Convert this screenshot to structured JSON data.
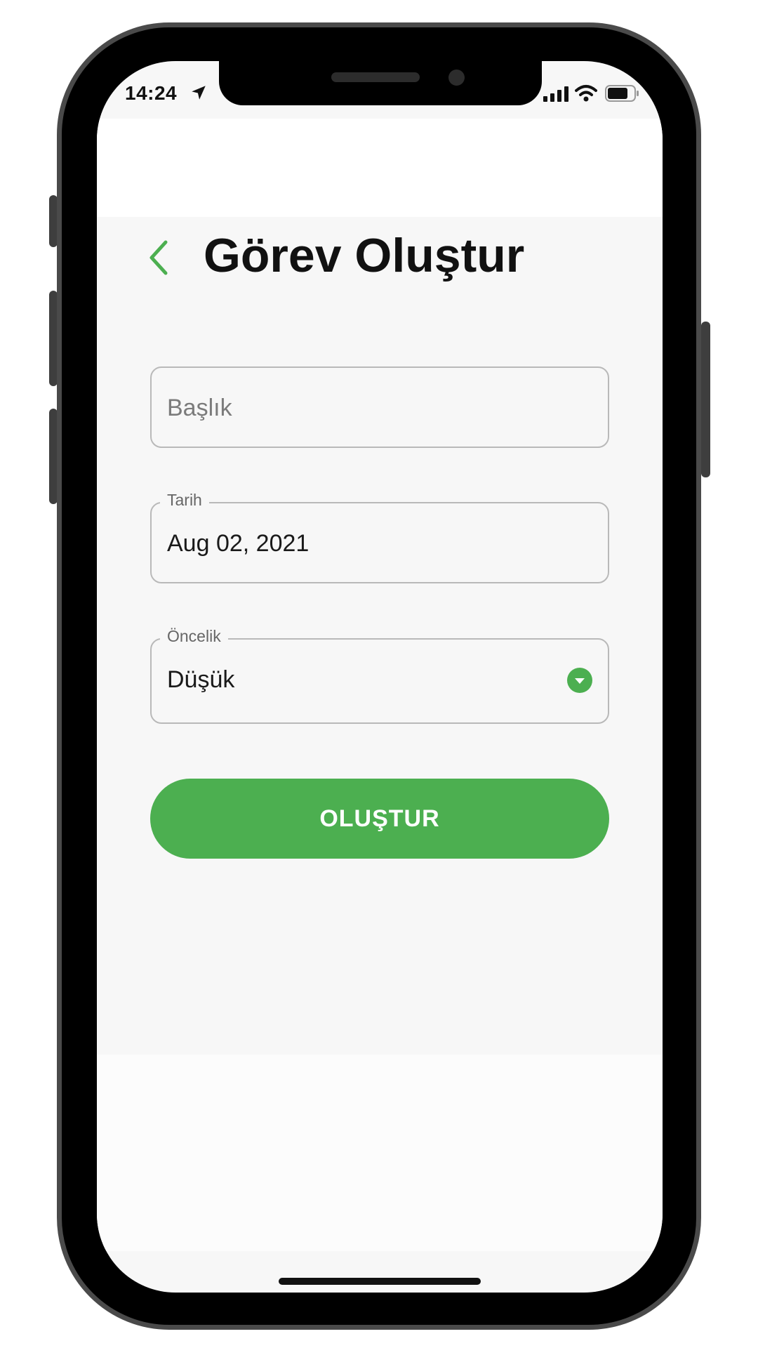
{
  "status_bar": {
    "time": "14:24",
    "location_icon": "location-arrow-icon",
    "signal_icon": "cellular-signal-icon",
    "wifi_icon": "wifi-icon",
    "battery_icon": "battery-icon"
  },
  "header": {
    "back_icon": "chevron-left-icon",
    "title": "Görev Oluştur"
  },
  "form": {
    "title_field": {
      "placeholder": "Başlık"
    },
    "date_field": {
      "label": "Tarih",
      "value": "Aug 02, 2021"
    },
    "priority_field": {
      "label": "Öncelik",
      "value": "Düşük",
      "dropdown_icon": "dropdown-circle-icon"
    },
    "submit_label": "OLUŞTUR"
  },
  "colors": {
    "accent": "#4caf50",
    "background": "#f7f7f7",
    "text": "#111111",
    "field_border": "#b9b9b9"
  }
}
